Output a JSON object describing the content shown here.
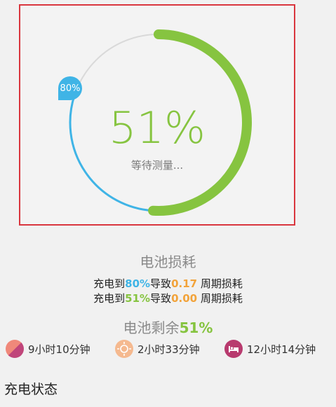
{
  "gauge": {
    "percent_text": "51%",
    "status_text": "等待测量...",
    "marker_text": "80%",
    "current_level": 0.51,
    "target_level": 0.8,
    "colors": {
      "green": "#86c440",
      "blue": "#3fb4e6",
      "track": "#d9d9d9"
    }
  },
  "wear": {
    "title": "电池损耗",
    "lines": [
      {
        "prefix": "充电到",
        "value": "80%",
        "mid": "导致",
        "amount": "0.17",
        "suffix": " 周期损耗"
      },
      {
        "prefix": "充电到",
        "value": "51%",
        "mid": "导致",
        "amount": "0.00",
        "suffix": " 周期损耗"
      }
    ]
  },
  "remaining": {
    "title": "电池剩余",
    "value": "51%",
    "items": [
      {
        "icon": "phone-usage-icon",
        "label": "9小时10分钟"
      },
      {
        "icon": "sun-icon",
        "label": "2小时33分钟"
      },
      {
        "icon": "bed-icon",
        "label": "12小时14分钟"
      }
    ]
  },
  "section": {
    "charge_status": "充电状态"
  }
}
